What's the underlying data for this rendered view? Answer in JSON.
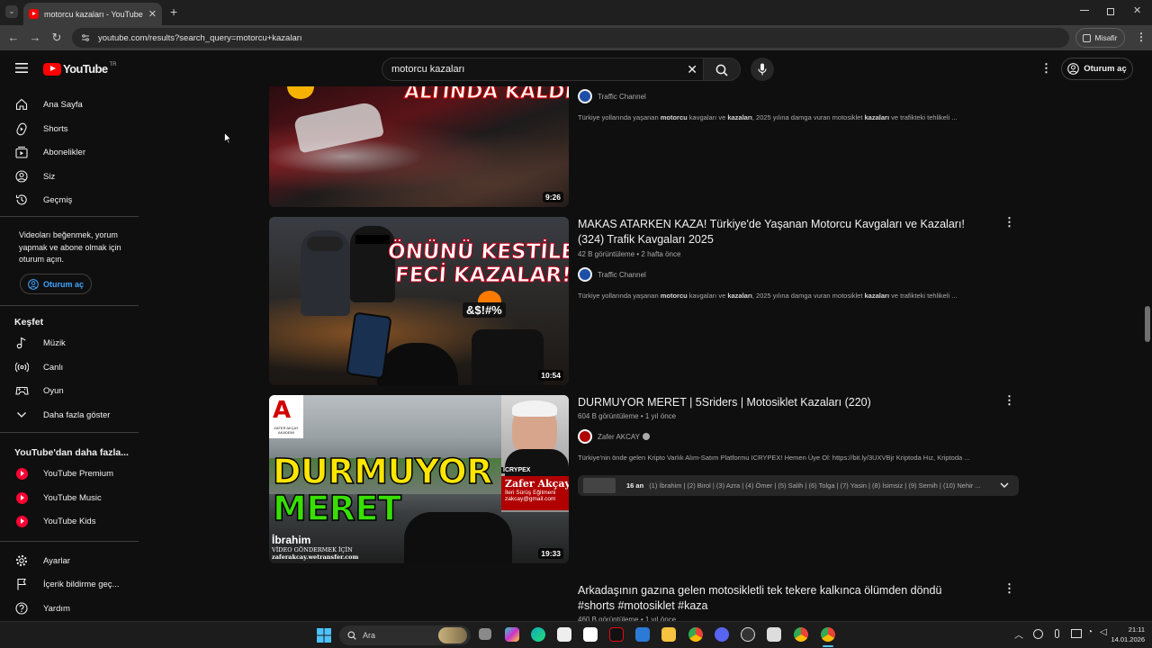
{
  "browser": {
    "tab_title": "motorcu kazaları - YouTube",
    "url": "youtube.com/results?search_query=motorcu+kazaları",
    "profile_label": "Misafir"
  },
  "header": {
    "logo_text": "YouTube",
    "logo_region": "TR",
    "search_query": "motorcu kazaları",
    "signin_label": "Oturum aç"
  },
  "sidebar": {
    "main": [
      {
        "label": "Ana Sayfa",
        "icon": "home-icon"
      },
      {
        "label": "Shorts",
        "icon": "shorts-icon"
      },
      {
        "label": "Abonelikler",
        "icon": "subscriptions-icon"
      },
      {
        "label": "Siz",
        "icon": "you-icon"
      },
      {
        "label": "Geçmiş",
        "icon": "history-icon"
      }
    ],
    "signin_prompt": "Videoları beğenmek, yorum yapmak ve abone olmak için oturum açın.",
    "signin_label": "Oturum aç",
    "explore_heading": "Keşfet",
    "explore": [
      {
        "label": "Müzik",
        "icon": "music-icon"
      },
      {
        "label": "Canlı",
        "icon": "live-icon"
      },
      {
        "label": "Oyun",
        "icon": "gaming-icon"
      },
      {
        "label": "Daha fazla göster",
        "icon": "chevron-down-icon"
      }
    ],
    "more_heading": "YouTube'dan daha fazla...",
    "more": [
      {
        "label": "YouTube Premium"
      },
      {
        "label": "YouTube Music"
      },
      {
        "label": "YouTube Kids"
      }
    ],
    "bottom": [
      {
        "label": "Ayarlar",
        "icon": "settings-icon"
      },
      {
        "label": "İçerik bildirme geç...",
        "icon": "flag-icon"
      },
      {
        "label": "Yardım",
        "icon": "help-icon"
      }
    ]
  },
  "results": [
    {
      "thumb_text": "ALTINDA KALDI!",
      "duration": "9:26",
      "channel": "Traffic Channel",
      "desc": [
        "Türkiye yollarında yaşanan ",
        "motorcu",
        " kavgaları ve ",
        "kazaları",
        ", 2025 yılına damga vuran motosiklet ",
        "kazaları",
        " ve trafikteki tehlikeli ..."
      ]
    },
    {
      "title": "MAKAS ATARKEN KAZA! Türkiye'de Yaşanan Motorcu Kavgaları ve Kazaları! (324) Trafik Kavgaları 2025",
      "meta": "42 B görüntüleme • 2 hafta önce",
      "thumb_line1": "ÖNÜNÜ KESTİLER!",
      "thumb_line2": "FECİ KAZALAR!",
      "thumb_badge": "&$!#%",
      "duration": "10:54",
      "channel": "Traffic Channel",
      "desc": [
        "Türkiye yollarında yaşanan ",
        "motorcu",
        " kavgaları ve ",
        "kazaları",
        ", 2025 yılına damga vuran motosiklet ",
        "kazaları",
        " ve trafikteki tehlikeli ..."
      ]
    },
    {
      "title": "DURMUYOR MERET | 5Sriders | Motosiklet Kazaları (220)",
      "meta": "604 B görüntüleme • 1 yıl önce",
      "thumb_line1": "DURMUYOR",
      "thumb_line2": "MERET",
      "thumb_name": "İbrahim",
      "thumb_sub1": "VİDEO GÖNDERMEK İÇİN",
      "thumb_sub2": "zaferakcay.wetransfer.com",
      "thumb_person": "Zafer Akçay",
      "thumb_person_sub": "İleri Sürüş Eğitmeni",
      "thumb_person_mail": "zakcay@gmail.com",
      "thumb_brand": "ICRYPEX",
      "thumb_logo": "ZAFER AKÇAY AKADEMİ",
      "duration": "19:33",
      "channel": "Zafer AKCAY",
      "desc_plain": "Türkiye'nin önde gelen Kripto Varlık Alım-Satım Platformu ICRYPEX! Hemen Üye Ol: https://bit.ly/3UXVBjr Kriptoda Hız, Kriptoda ...",
      "chapters_count": "16 an",
      "chapters_text": "(1) İbrahim | (2) Birol | (3) Azra | (4) Ömer | (5) Salih | (6) Tolga | (7) Yasin | (8) İsimsiz | (9) Semih | (10) Nehir ..."
    },
    {
      "title": "Arkadaşının gazına gelen motosikletli tek tekere kalkınca ölümden döndü #shorts #motosiklet #kaza",
      "meta": "460 B görüntüleme • 1 yıl önce"
    }
  ],
  "taskbar": {
    "search_label": "Ara",
    "time": "21:11",
    "date": "14.01.2026"
  },
  "colors": {
    "background": "#0f0f0f",
    "youtube_red": "#ff0000",
    "link_blue": "#3ea6ff",
    "thumb_yellow": "#ffe600",
    "thumb_green": "#38e000"
  }
}
